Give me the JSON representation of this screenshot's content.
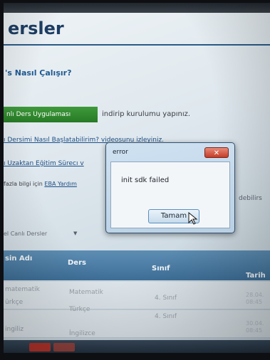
{
  "page": {
    "title": "ersler",
    "how_heading": "'s Nasıl Çalışır?",
    "download_button": "nlı Ders Uygulaması",
    "download_text": "indirip kurulumu yapınız.",
    "link1": "ı Dersimi Nasıl Başlatabilirim? videosunu izleyiniz.",
    "link2": "ı Uzaktan Eğitim Sürecı v",
    "more_info_prefix": "fazla bilgi için",
    "more_info_link": "EBA Yardım",
    "right_fragment": "debilirs",
    "filter_label": "el Canlı Dersler",
    "filter_caret": "▼"
  },
  "table": {
    "headers": {
      "name": "sin Adı",
      "course": "Ders",
      "class": "Sınıf",
      "date": "Tarih"
    },
    "rows": [
      {
        "name": "matematik",
        "course": "Matematik",
        "class": "4. Sınıf",
        "date_line1": "28.04.",
        "date_line2": "08:45"
      },
      {
        "name": "ürkçe",
        "course": "Türkçe",
        "class": "4. Sınıf",
        "date_line1": "30.04.",
        "date_line2": "08:45"
      }
    ],
    "partial_row": {
      "name": "ingiliz",
      "course": "İngilizce"
    }
  },
  "dialog": {
    "title": "error",
    "close_symbol": "✕",
    "message": "init sdk failed",
    "ok_label": "Tamam"
  }
}
